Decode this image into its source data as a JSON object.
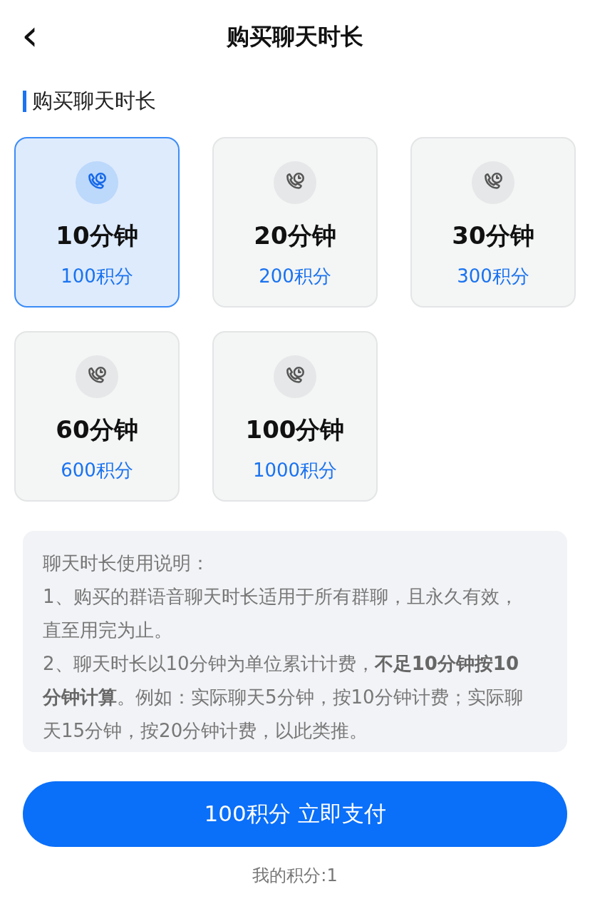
{
  "header": {
    "back": "‹",
    "title": "购买聊天时长"
  },
  "section_title": "购买聊天时长",
  "options": [
    {
      "duration": "10分钟",
      "price": "100积分",
      "selected": true
    },
    {
      "duration": "20分钟",
      "price": "200积分",
      "selected": false
    },
    {
      "duration": "30分钟",
      "price": "300积分",
      "selected": false
    },
    {
      "duration": "60分钟",
      "price": "600积分",
      "selected": false
    },
    {
      "duration": "100分钟",
      "price": "1000积分",
      "selected": false
    }
  ],
  "notes": [
    "聊天时长使用说明：",
    "1、购买的群语音聊天时长适用于所有群聊，且永久有效，直至用完为止。",
    "2、聊天时长以10分钟为单位累计计费，**不足10分钟按10分钟计算**。例如：实际聊天5分钟，按10分钟计费；实际聊天15分钟，按20分钟计费，以此类推。"
  ],
  "pay_button": "100积分 立即支付",
  "my_points": "我的积分:1"
}
